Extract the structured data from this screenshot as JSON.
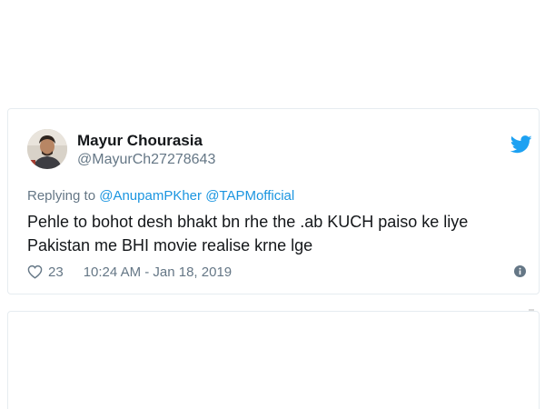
{
  "tweet": {
    "display_name": "Mayur Chourasia",
    "handle": "@MayurCh27278643",
    "replying_prefix": "Replying to",
    "mentions": [
      "@AnupamPKher",
      "@TAPMofficial"
    ],
    "text_line1": "Pehle to bohot desh bhakt bn rhe the .ab KUCH paiso ke liye",
    "text_line2": "Pakistan me BHI movie realise krne lge",
    "like_count": "23",
    "timestamp": "10:24 AM - Jan 18, 2019"
  },
  "icons": {
    "brand": "twitter-bird-icon",
    "like": "heart-icon",
    "info": "info-icon"
  },
  "colors": {
    "brand_blue": "#1da1f2",
    "mention_blue": "#1b95e0",
    "secondary_text": "#657786",
    "primary_text": "#14171a",
    "border": "#e6ecf0"
  }
}
